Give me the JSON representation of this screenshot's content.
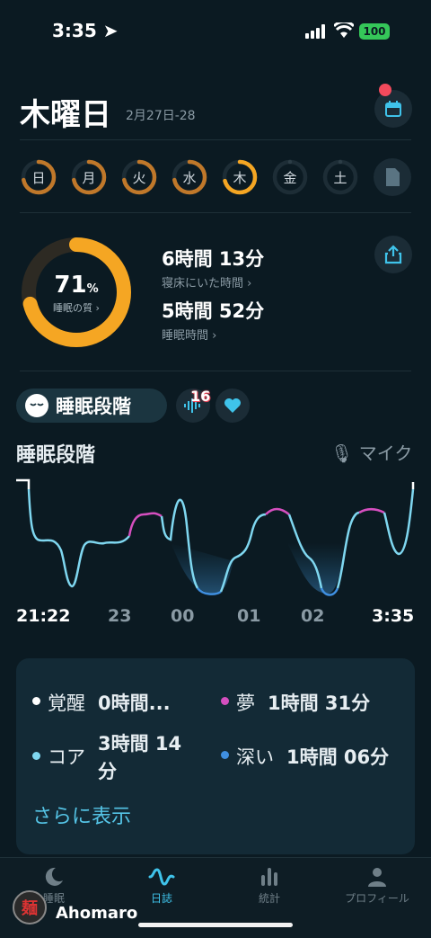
{
  "status": {
    "time": "3:35",
    "battery": "100"
  },
  "header": {
    "title": "木曜日",
    "date_range": "2月27日-28"
  },
  "week": [
    {
      "label": "日",
      "progress": 0.72,
      "color": "#c0782a"
    },
    {
      "label": "月",
      "progress": 0.72,
      "color": "#c0782a"
    },
    {
      "label": "火",
      "progress": 0.72,
      "color": "#c0782a"
    },
    {
      "label": "水",
      "progress": 0.72,
      "color": "#c0782a"
    },
    {
      "label": "木",
      "progress": 0.71,
      "color": "#f5a623"
    },
    {
      "label": "金",
      "progress": 0,
      "color": "#2c3d46"
    },
    {
      "label": "土",
      "progress": 0,
      "color": "#2c3d46"
    }
  ],
  "summary": {
    "score": "71",
    "score_unit": "%",
    "score_fraction": 0.71,
    "quality_label": "睡眠の質 ›",
    "bed_time_value": "6時間 13分",
    "bed_time_label": "寝床にいた時間 ›",
    "sleep_time_value": "5時間 52分",
    "sleep_time_label": "睡眠時間 ›"
  },
  "chips": {
    "stages": "睡眠段階",
    "snore_badge": "16"
  },
  "chart_data": {
    "type": "line",
    "title": "睡眠段階",
    "source_label": "マイク",
    "x_ticks": [
      "21:22",
      "23",
      "00",
      "01",
      "02",
      "3:35"
    ],
    "stages": [
      "覚醒",
      "夢",
      "コア",
      "深い"
    ],
    "colors": {
      "覚醒": "#ffffff",
      "夢": "#d54fbf",
      "コア": "#7fd7f0",
      "深い": "#3f8fe0"
    }
  },
  "legend": [
    {
      "name": "覚醒",
      "value": "0時間...",
      "color": "#ffffff"
    },
    {
      "name": "夢",
      "value": "1時間 31分",
      "color": "#d54fbf"
    },
    {
      "name": "コア",
      "value": "3時間 14分",
      "color": "#7fd7f0"
    },
    {
      "name": "深い",
      "value": "1時間 06分",
      "color": "#3f8fe0"
    }
  ],
  "more_label": "さらに表示",
  "tabs": [
    {
      "label": "睡眠"
    },
    {
      "label": "日誌"
    },
    {
      "label": "統計"
    },
    {
      "label": "プロフィール"
    }
  ],
  "user": {
    "name": "Ahomaro",
    "avatar_char": "麺"
  }
}
